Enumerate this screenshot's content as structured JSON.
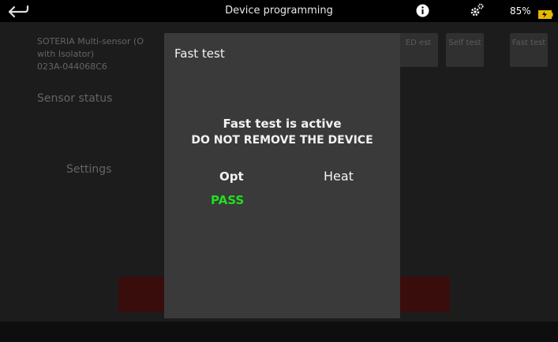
{
  "status_bar": {
    "title": "Device programming",
    "battery_percent": "85%",
    "back_icon": "back-arrow-icon",
    "info_icon": "info-icon",
    "settings_icon": "gear-icon",
    "battery_icon": "battery-icon"
  },
  "background": {
    "device_name_line1": "SOTERIA Multi-sensor (O",
    "device_name_line2": "with Isolator)",
    "device_id": "023A-044068C6",
    "sensor_status": "Sensor status",
    "settings": "Settings",
    "buttons": [
      {
        "label": "ED est"
      },
      {
        "label": "Self test"
      },
      {
        "label": "Fast test"
      }
    ]
  },
  "dialog": {
    "title": "Fast test",
    "active_message": "Fast test is active",
    "warning_message": "DO NOT REMOVE THE DEVICE",
    "columns": {
      "opt": "Opt",
      "heat": "Heat"
    },
    "opt_result": "PASS"
  },
  "colors": {
    "pass": "#22dd22",
    "accent_red": "#5a1515",
    "battery": "#e6b800"
  }
}
